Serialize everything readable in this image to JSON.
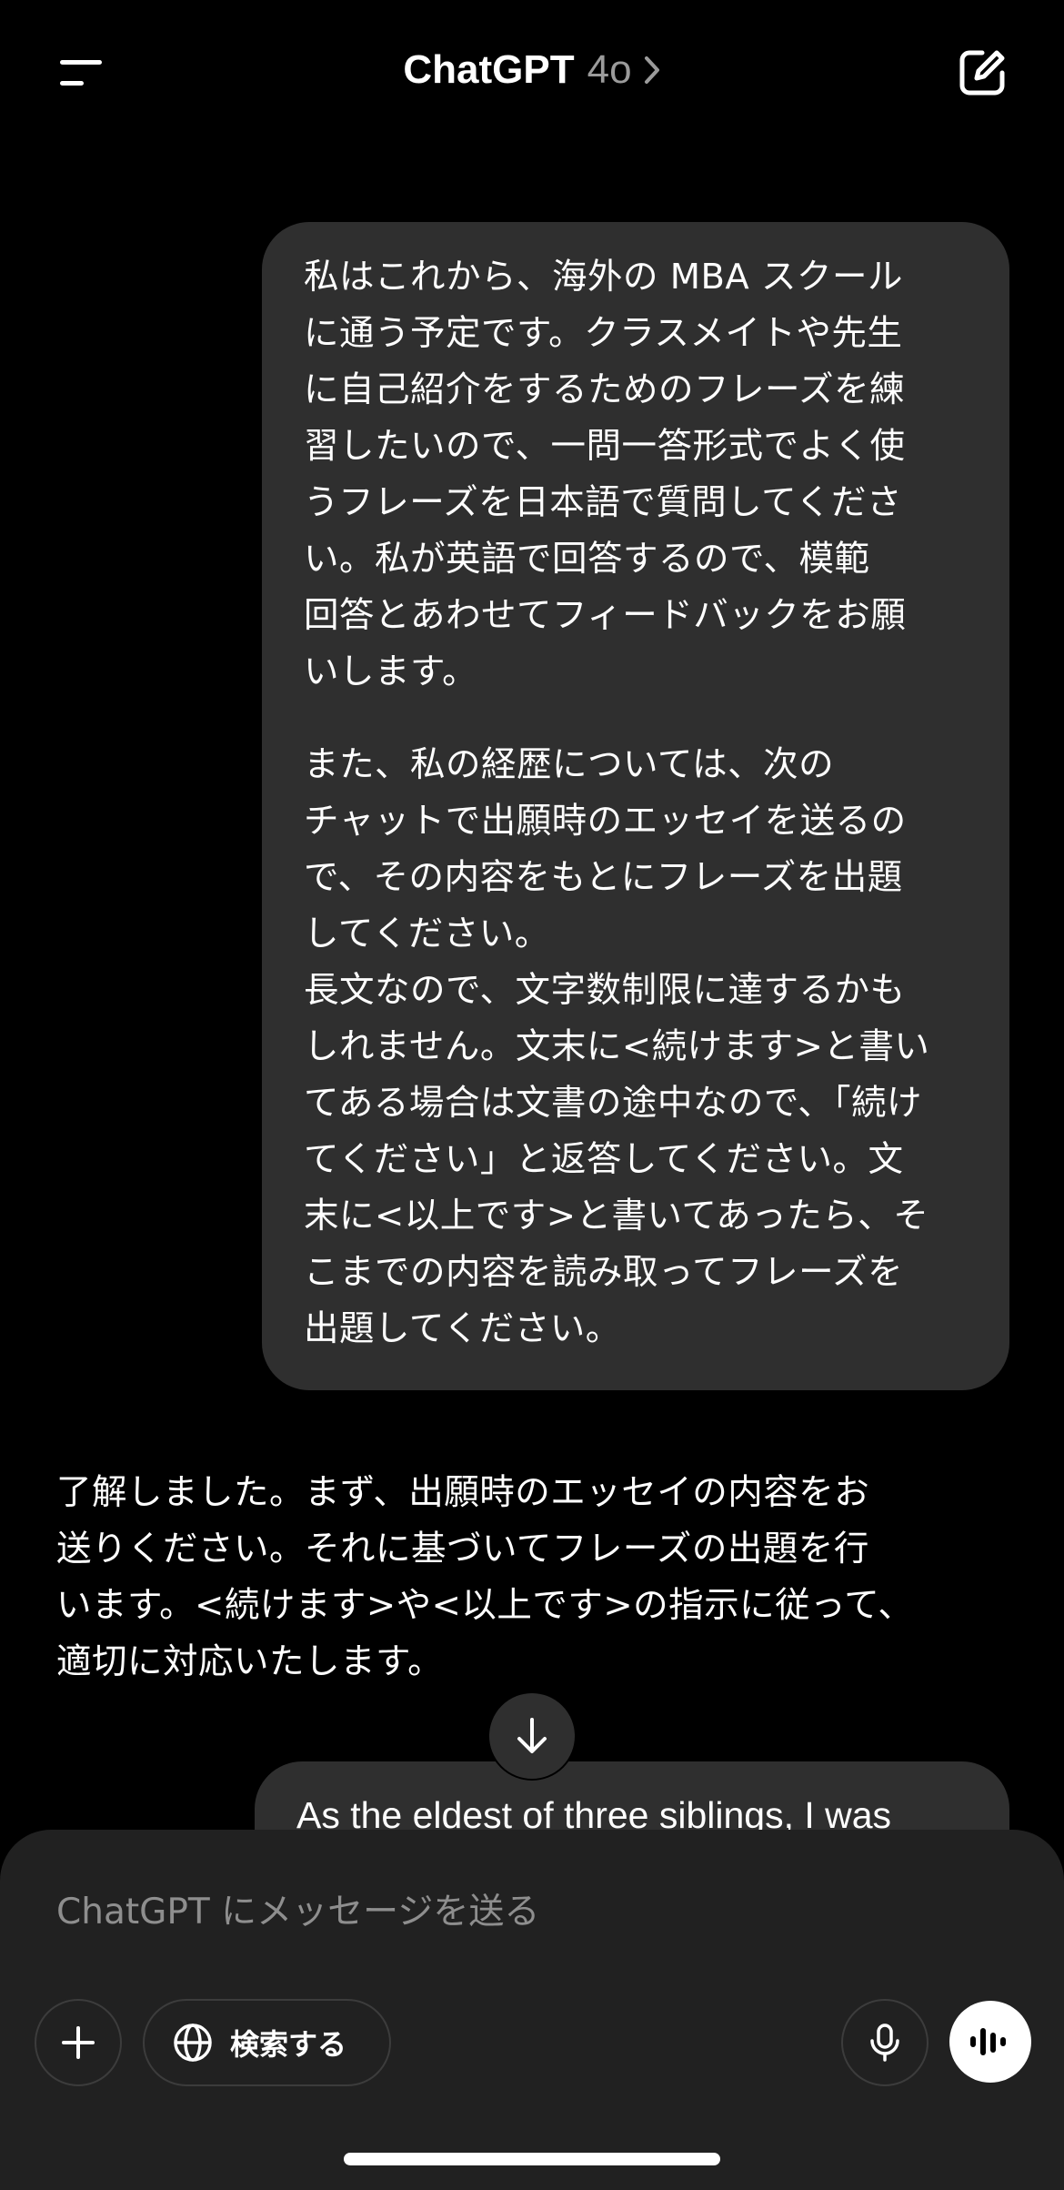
{
  "header": {
    "title": "ChatGPT",
    "model": "4o",
    "menu_icon": "sidebar-menu-icon",
    "chevron_icon": "chevron-right-icon",
    "new_chat_icon": "compose-icon"
  },
  "conversation": {
    "user_message_1": {
      "paragraph_1": "私はこれから、海外の MBA スクール\nに通う予定です。クラスメイトや先生\nに自己紹介をするためのフレーズを練\n習したいので、一問一答形式でよく使\nうフレーズを日本語で質問してくださ\nい。私が英語で回答するので、模範\n回答とあわせてフィードバックをお願\nいします。",
      "paragraph_2": "また、私の経歴については、次の\nチャットで出願時のエッセイを送るの\nで、その内容をもとにフレーズを出題\nしてください。\n長文なので、文字数制限に達するかも\nしれません。文末に<続けます>と書い\nてある場合は文書の途中なので、「続け\nてください」と返答してください。文\n末に<以上です>と書いてあったら、そ\nこまでの内容を読み取ってフレーズを\n出題してください。"
    },
    "assistant_message_1": "了解しました。まず、出願時のエッセイの内容をお\n送りください。それに基づいてフレーズの出題を行\nいます。<続けます>や<以上です>の指示に従って、\n適切に対応いたします。",
    "user_message_2_preview": "As the eldest of three siblings, I was"
  },
  "scroll_button": {
    "icon": "arrow-down-icon"
  },
  "composer": {
    "placeholder": "ChatGPT にメッセージを送る",
    "search_label": "検索する",
    "plus_icon": "plus-icon",
    "globe_icon": "globe-icon",
    "mic_icon": "microphone-icon",
    "voice_icon": "voice-mode-icon"
  }
}
